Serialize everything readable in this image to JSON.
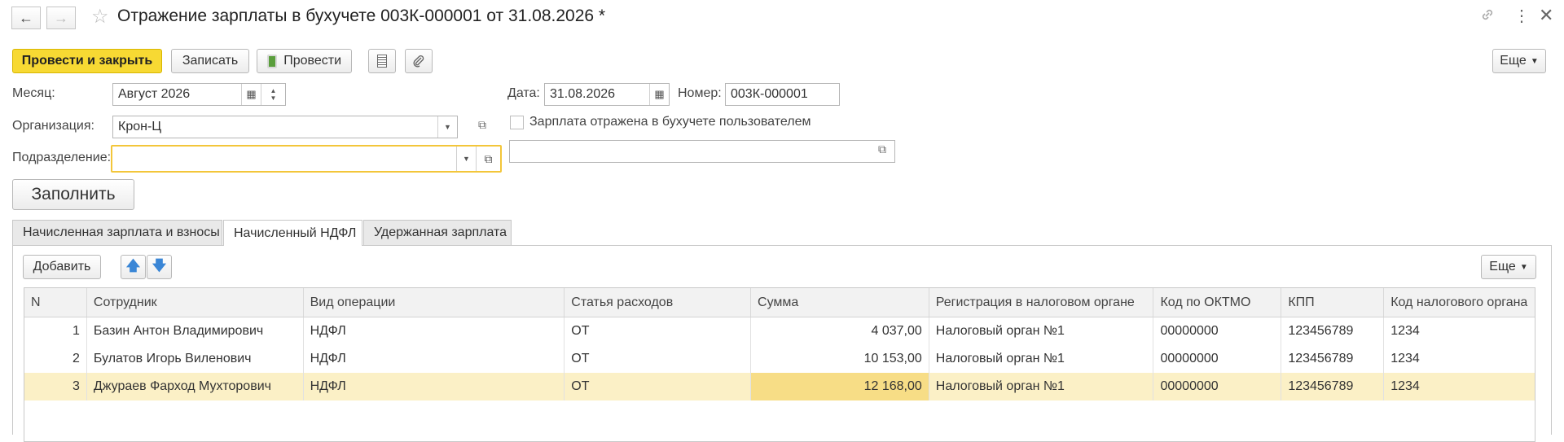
{
  "header": {
    "title": "Отражение зарплаты в бухучете 003К-000001 от 31.08.2026 *"
  },
  "toolbar": {
    "post_close_label": "Провести и закрыть",
    "save_label": "Записать",
    "post_label": "Провести",
    "more_label": "Еще"
  },
  "form": {
    "month_label": "Месяц:",
    "month_value": "Август 2026",
    "date_label": "Дата:",
    "date_value": "31.08.2026",
    "number_label": "Номер:",
    "number_value": "003К-000001",
    "org_label": "Организация:",
    "org_value": "Крон-Ц",
    "checkbox_label": "Зарплата отражена в бухучете пользователем",
    "checkbox_checked": false,
    "subdivision_label": "Подразделение:",
    "subdivision_value": "",
    "user_value": "",
    "fill_label": "Заполнить"
  },
  "tabs": [
    {
      "label": "Начисленная зарплата и взносы",
      "active": false
    },
    {
      "label": "Начисленный НДФЛ",
      "active": true
    },
    {
      "label": "Удержанная зарплата",
      "active": false
    }
  ],
  "table_toolbar": {
    "add_label": "Добавить",
    "more_label": "Еще"
  },
  "table": {
    "columns": [
      "N",
      "Сотрудник",
      "Вид операции",
      "Статья расходов",
      "Сумма",
      "Регистрация в налоговом органе",
      "Код по ОКТМО",
      "КПП",
      "Код налогового органа"
    ],
    "rows": [
      [
        "1",
        "Базин Антон Владимирович",
        "НДФЛ",
        "ОТ",
        "4 037,00",
        "Налоговый орган №1",
        "00000000",
        "123456789",
        "1234"
      ],
      [
        "2",
        "Булатов Игорь Виленович",
        "НДФЛ",
        "ОТ",
        "10 153,00",
        "Налоговый орган №1",
        "00000000",
        "123456789",
        "1234"
      ],
      [
        "3",
        "Джураев Фарход Мухторович",
        "НДФЛ",
        "ОТ",
        "12 168,00",
        "Налоговый орган №1",
        "00000000",
        "123456789",
        "1234"
      ]
    ],
    "selected_row": 3
  },
  "colors": {
    "accent": "#f7d933",
    "selected_row": "#fbf0c6",
    "selected_cell": "#f7dd86",
    "focus_border": "#f3c63a"
  }
}
